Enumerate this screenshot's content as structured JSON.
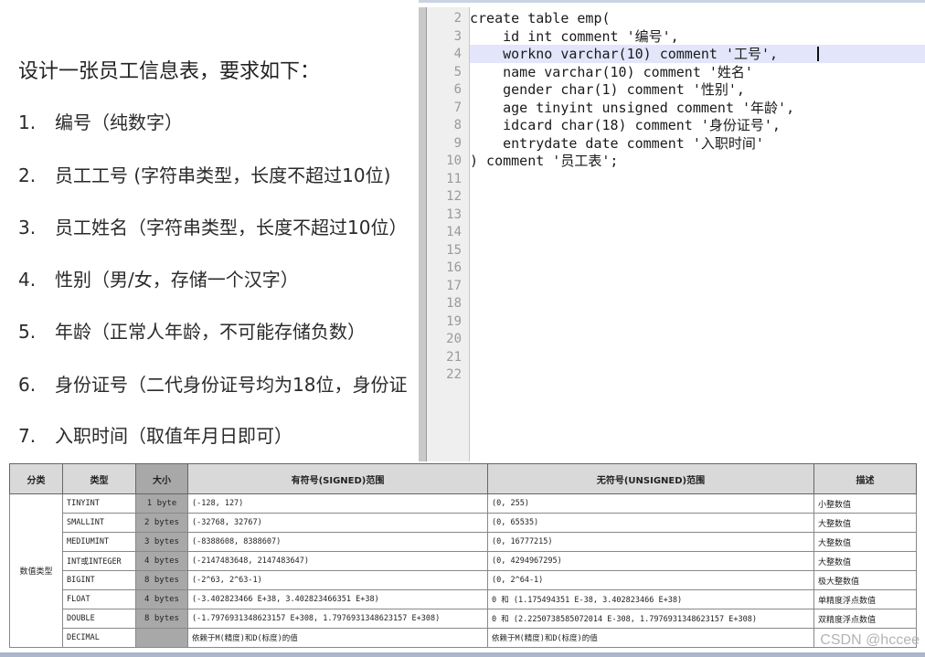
{
  "requirements": {
    "title": "设计一张员工信息表，要求如下：",
    "items": [
      {
        "num": "1.",
        "text": "编号（纯数字）"
      },
      {
        "num": "2.",
        "text": "员工工号 (字符串类型，长度不超过10位)"
      },
      {
        "num": "3.",
        "text": "员工姓名（字符串类型，长度不超过10位）"
      },
      {
        "num": "4.",
        "text": "性别（男/女，存储一个汉字）"
      },
      {
        "num": "5.",
        "text": "年龄（正常人年龄，不可能存储负数）"
      },
      {
        "num": "6.",
        "text": "身份证号（二代身份证号均为18位，身份证"
      },
      {
        "num": "7.",
        "text": "入职时间（取值年月日即可）"
      }
    ]
  },
  "editor": {
    "line_numbers": [
      "2",
      "3",
      "4",
      "5",
      "6",
      "7",
      "8",
      "9",
      "10",
      "11",
      "12",
      "13",
      "14",
      "15",
      "16",
      "17",
      "18",
      "19",
      "20",
      "21",
      "22"
    ],
    "lines": [
      "create table emp(",
      "    id int comment '编号',",
      "    workno varchar(10) comment '工号',",
      "    name varchar(10) comment '姓名'",
      "    gender char(1) comment '性别',",
      "    age tinyint unsigned comment '年龄',",
      "    idcard char(18) comment '身份证号',",
      "    entrydate date comment '入职时间'",
      ") comment '员工表';"
    ],
    "highlighted_line": "4"
  },
  "table": {
    "headers": [
      "分类",
      "类型",
      "大小",
      "有符号(SIGNED)范围",
      "无符号(UNSIGNED)范围",
      "描述"
    ],
    "category": "数值类型",
    "rows": [
      {
        "type": "TINYINT",
        "size": "1 byte",
        "signed": "(-128, 127)",
        "unsigned": "(0, 255)",
        "desc": "小整数值"
      },
      {
        "type": "SMALLINT",
        "size": "2 bytes",
        "signed": "(-32768, 32767)",
        "unsigned": "(0, 65535)",
        "desc": "大整数值"
      },
      {
        "type": "MEDIUMINT",
        "size": "3 bytes",
        "signed": "(-8388608, 8388607)",
        "unsigned": "(0, 16777215)",
        "desc": "大整数值"
      },
      {
        "type": "INT或INTEGER",
        "size": "4 bytes",
        "signed": "(-2147483648, 2147483647)",
        "unsigned": "(0, 4294967295)",
        "desc": "大整数值"
      },
      {
        "type": "BIGINT",
        "size": "8 bytes",
        "signed": "(-2^63, 2^63-1)",
        "unsigned": "(0, 2^64-1)",
        "desc": "极大整数值"
      },
      {
        "type": "FLOAT",
        "size": "4 bytes",
        "signed": "(-3.402823466 E+38, 3.402823466351 E+38)",
        "unsigned": "0 和 (1.175494351 E-38, 3.402823466 E+38)",
        "desc": "单精度浮点数值"
      },
      {
        "type": "DOUBLE",
        "size": "8 bytes",
        "signed": "(-1.7976931348623157 E+308, 1.7976931348623157 E+308)",
        "unsigned": "0 和 (2.2250738585072014 E-308, 1.7976931348623157 E+308)",
        "desc": "双精度浮点数值"
      },
      {
        "type": "DECIMAL",
        "size": "",
        "signed": "依赖于M(精度)和D(标度)的值",
        "unsigned": "依赖于M(精度)和D(标度)的值",
        "desc": ""
      }
    ]
  },
  "watermark": "CSDN @hccee"
}
